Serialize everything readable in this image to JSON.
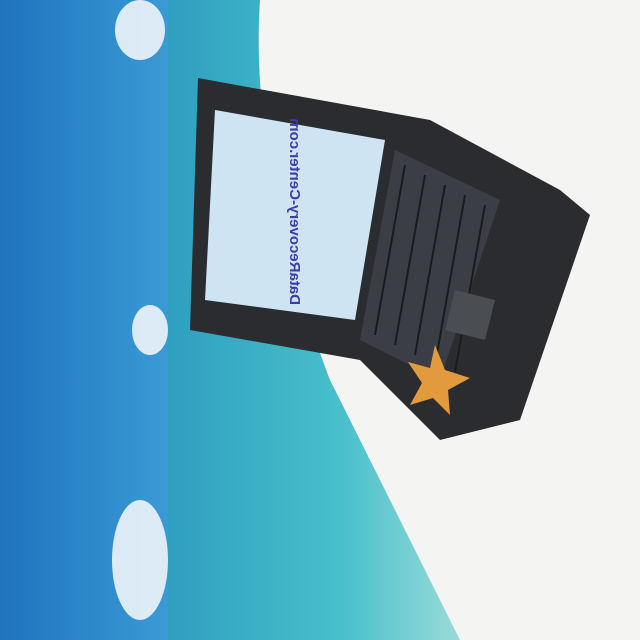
{
  "photo": {
    "subject": "laptop on beach with starfish",
    "screen_text": "DataRecovery-Center.com",
    "colors": {
      "sky": "#2a86c9",
      "sea": "#3fb3c4",
      "sand": "#f4f4f2",
      "laptop": "#2a2c30",
      "screen": "#cfe4f2",
      "starfish": "#e39a3c"
    }
  }
}
